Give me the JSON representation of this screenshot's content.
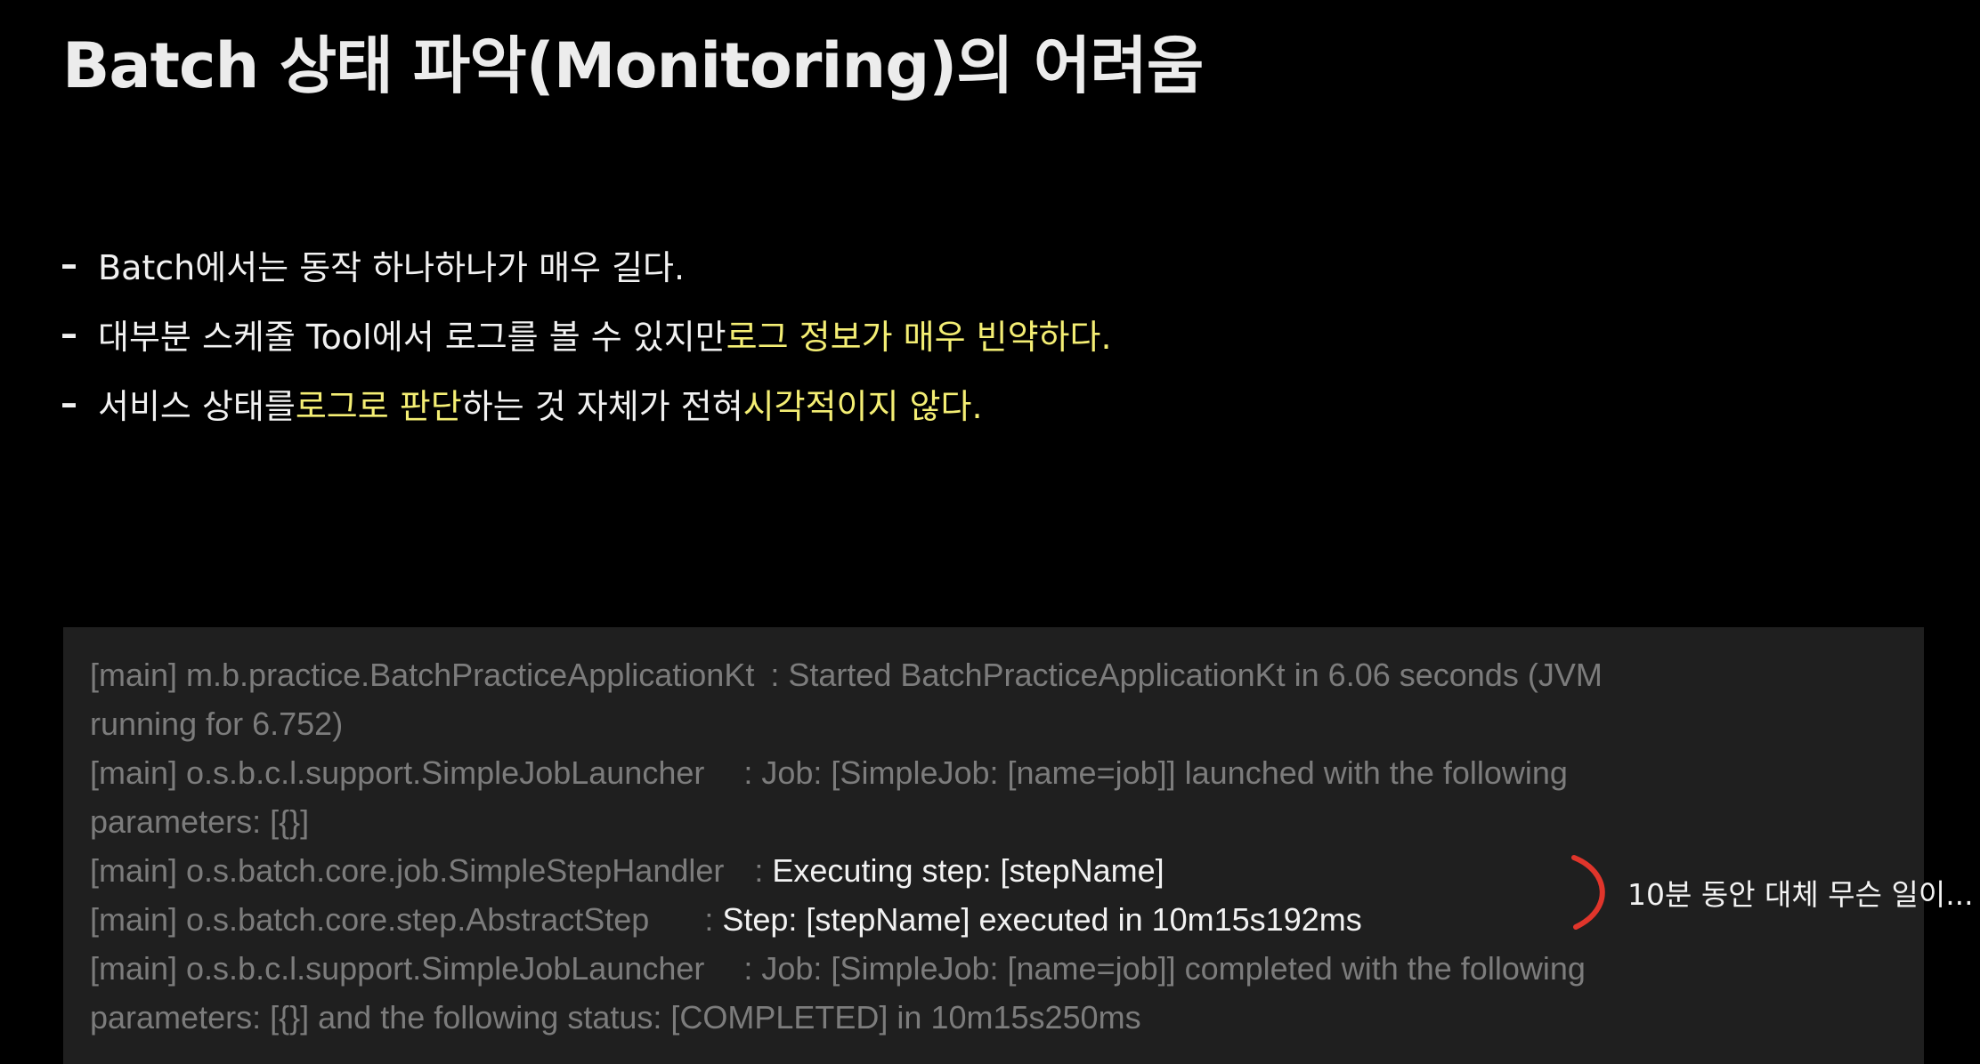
{
  "title": "Batch 상태 파악(Monitoring)의 어려움",
  "bullets": [
    {
      "dash": "–",
      "parts": [
        "Batch에서는 동작 하나하나가 매우 길다."
      ]
    },
    {
      "dash": "–",
      "parts": [
        "대부분 스케줄 Tool에서 로그를 볼 수 있지만 ",
        "로그 정보가 매우 빈약하다."
      ]
    },
    {
      "dash": "–",
      "parts": [
        "서비스 상태를 ",
        "로그로 판단",
        "하는 것 자체가 전혀 ",
        "시각적이지 않다."
      ]
    }
  ],
  "log": {
    "lines": [
      {
        "logger": "[main] m.b.practice.BatchPracticeApplicationKt",
        "message": ": Started BatchPracticeApplicationKt in 6.06 seconds (JVM"
      },
      {
        "logger": "",
        "message": "running for 6.752)"
      },
      {
        "logger": "[main] o.s.b.c.l.support.SimpleJobLauncher",
        "message": ": Job: [SimpleJob: [name=job]] launched with the following"
      },
      {
        "logger": "",
        "message": "parameters: [{}]"
      },
      {
        "logger": "[main] o.s.batch.core.job.SimpleStepHandler",
        "message": ": ",
        "highlight": "Executing step: [stepName]"
      },
      {
        "logger": "[main] o.s.batch.core.step.AbstractStep",
        "message": ": ",
        "highlight": "Step: [stepName] executed in 10m15s192ms"
      },
      {
        "logger": "[main] o.s.b.c.l.support.SimpleJobLauncher",
        "message": ": Job: [SimpleJob: [name=job]] completed with the following"
      },
      {
        "logger": "",
        "message": "parameters: [{}] and the following status: [COMPLETED] in 10m15s250ms"
      }
    ]
  },
  "annotation": {
    "text": "10분 동안 대체 무슨 일이...",
    "bracket_color": "#e0352b"
  },
  "colors": {
    "background": "#000000",
    "highlight": "#f4ee74",
    "log_background": "#1f1f1f",
    "log_dim": "#7c7c7c"
  }
}
